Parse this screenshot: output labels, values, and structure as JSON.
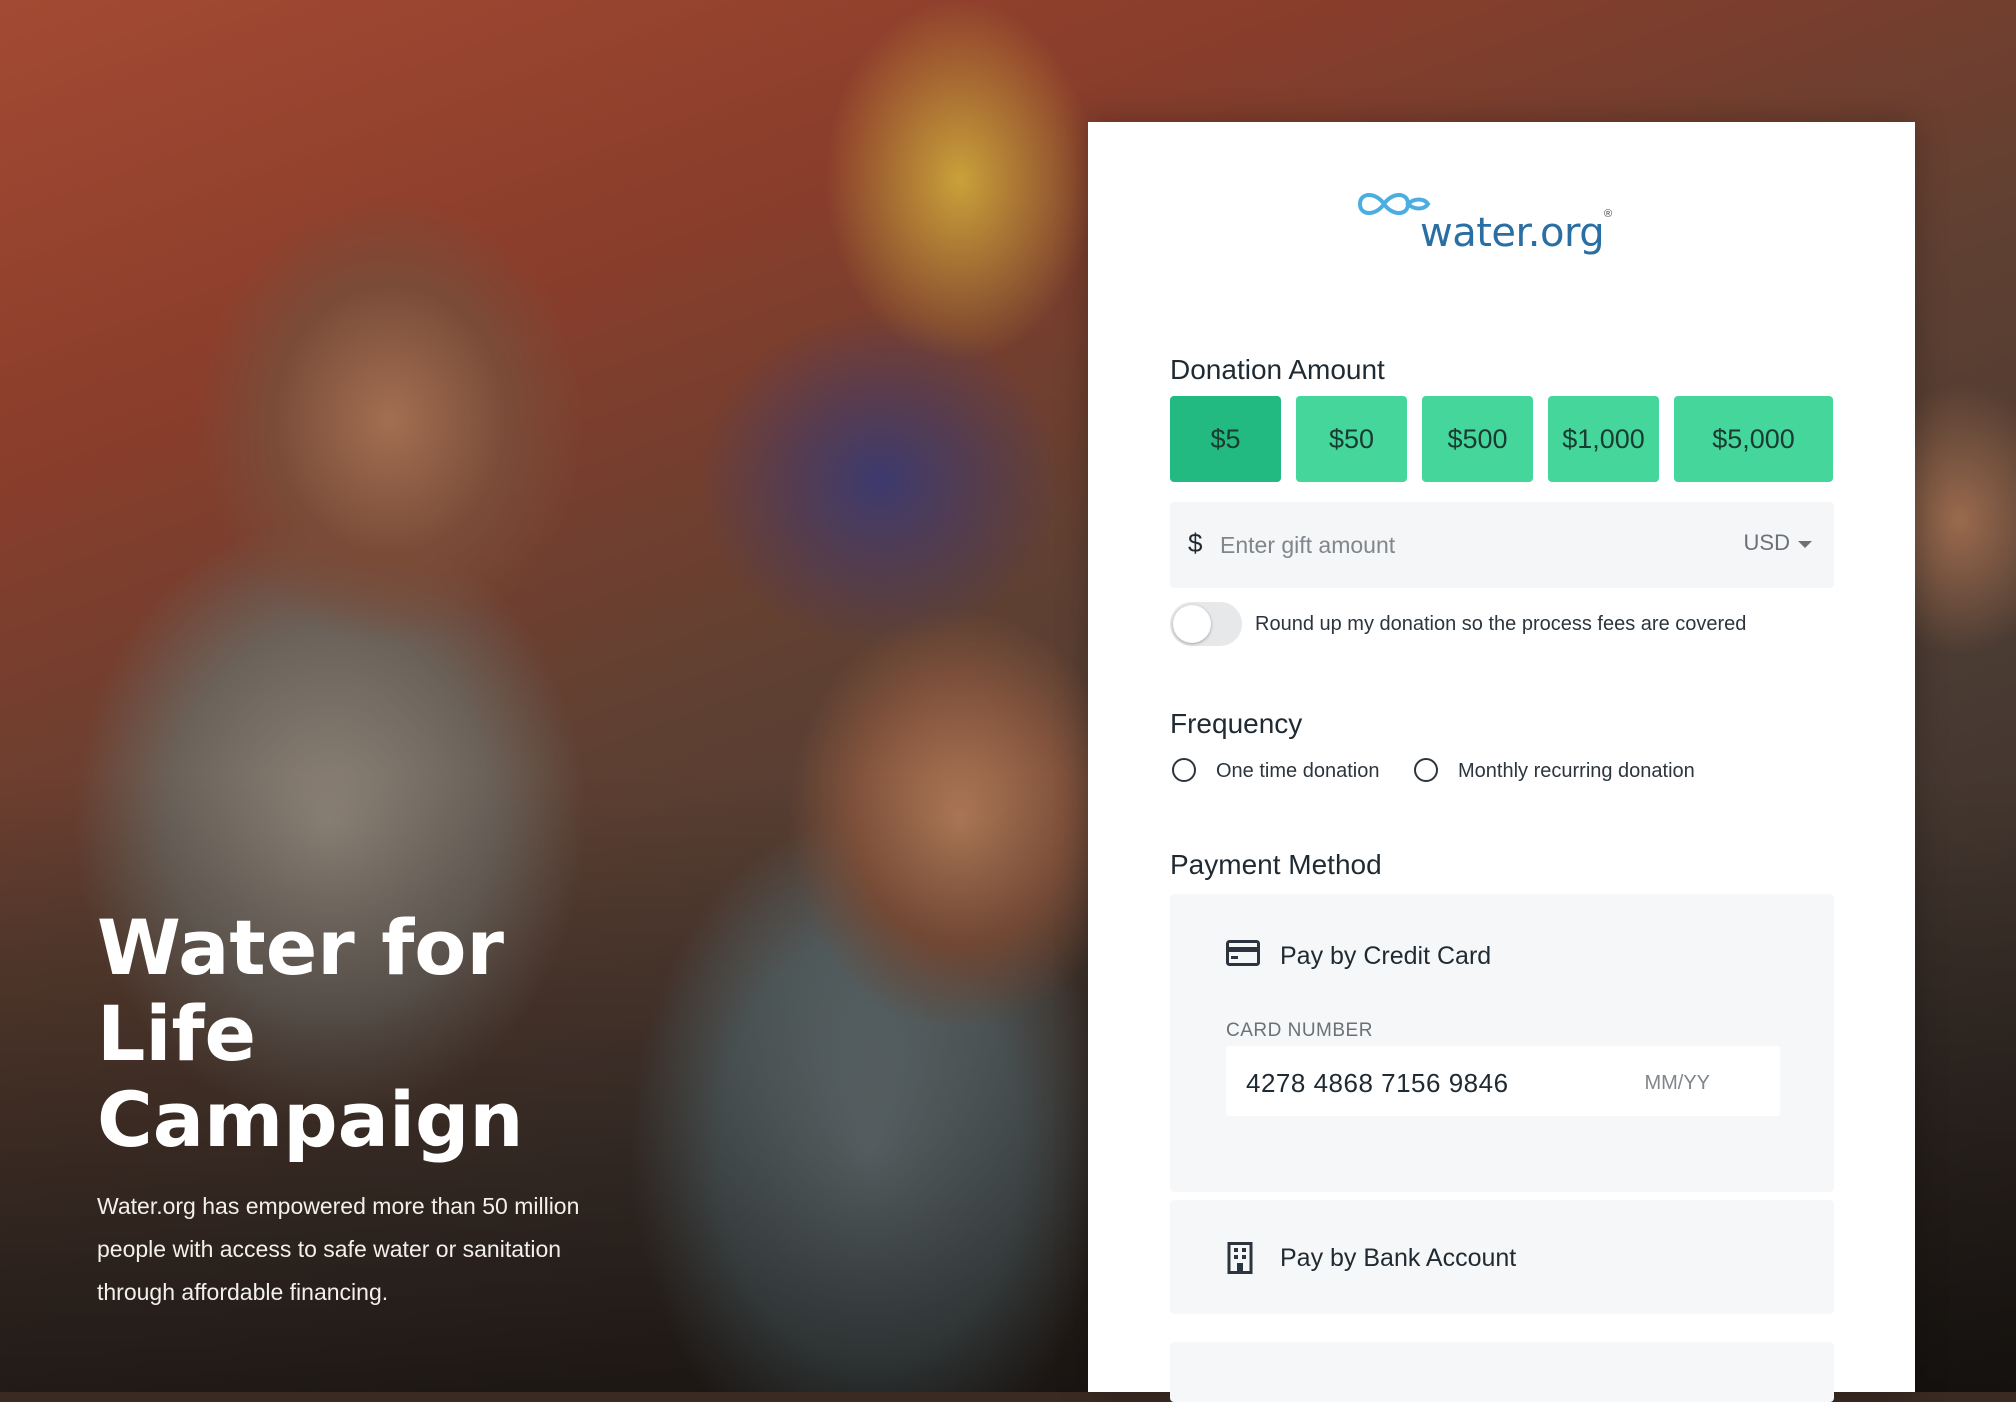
{
  "campaign": {
    "title_line1": "Water for",
    "title_line2": "Life",
    "title_line3": "Campaign",
    "description": "Water.org has empowered more than 50 million people with access to safe water or sanitation through affordable financing."
  },
  "logo": {
    "text": "water.org",
    "registered": "®"
  },
  "donation": {
    "heading": "Donation Amount",
    "amounts": [
      "$5",
      "$50",
      "$500",
      "$1,000",
      "$5,000"
    ],
    "selected_amount": "$5",
    "currency_symbol": "$",
    "gift_placeholder": "Enter gift amount",
    "currency": "USD",
    "roundup_label": "Round up my donation so the process fees are covered",
    "roundup_enabled": false
  },
  "frequency": {
    "heading": "Frequency",
    "options": [
      "One time donation",
      "Monthly recurring donation"
    ]
  },
  "payment": {
    "heading": "Payment Method",
    "credit_card_title": "Pay by Credit Card",
    "card_number_label": "CARD NUMBER",
    "card_number_value": "4278 4868 7156 9846",
    "expiry_placeholder": "MM/YY",
    "bank_account_title": "Pay by Bank Account"
  },
  "colors": {
    "amount_button": "#45d69b",
    "amount_button_selected": "#22ba80",
    "logo_blue": "#2a6fa3",
    "logo_light_blue": "#4aaee0"
  },
  "icons": [
    "water-org-logo-icon",
    "credit-card-icon",
    "bank-building-icon",
    "caret-down-icon"
  ]
}
